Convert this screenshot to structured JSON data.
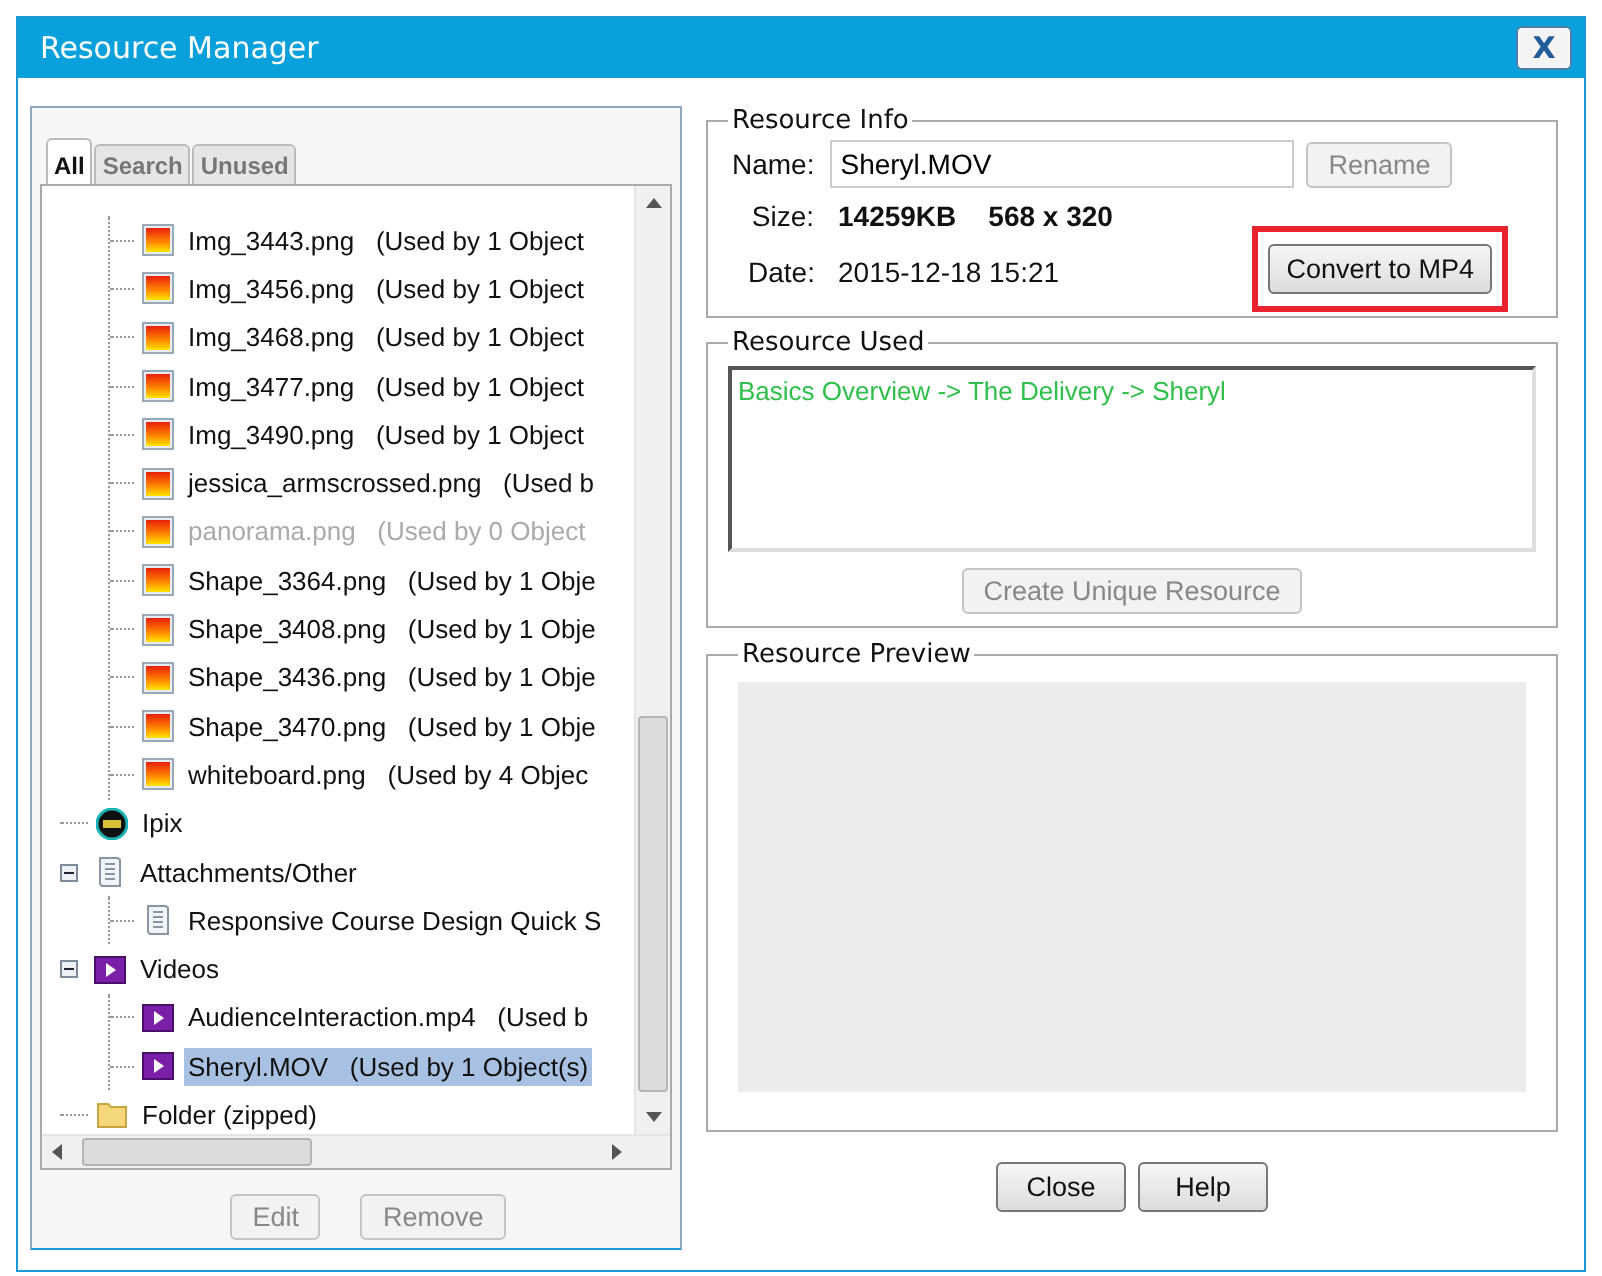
{
  "window": {
    "title": "Resource Manager",
    "close_label": "X"
  },
  "tabs": [
    {
      "label": "All",
      "selected": true
    },
    {
      "label": "Search",
      "selected": false
    },
    {
      "label": "Unused",
      "selected": false
    }
  ],
  "tree": {
    "scrolled_children": [
      {
        "kind": "image",
        "name": "Img_3443.png",
        "usage": "(Used by 1 Object",
        "dimmed": false,
        "selected": false
      },
      {
        "kind": "image",
        "name": "Img_3456.png",
        "usage": "(Used by 1 Object",
        "dimmed": false,
        "selected": false
      },
      {
        "kind": "image",
        "name": "Img_3468.png",
        "usage": "(Used by 1 Object",
        "dimmed": false,
        "selected": false
      },
      {
        "kind": "image",
        "name": "Img_3477.png",
        "usage": "(Used by 1 Object",
        "dimmed": false,
        "selected": false
      },
      {
        "kind": "image",
        "name": "Img_3490.png",
        "usage": "(Used by 1 Object",
        "dimmed": false,
        "selected": false
      },
      {
        "kind": "image",
        "name": "jessica_armscrossed.png",
        "usage": "(Used b",
        "dimmed": false,
        "selected": false
      },
      {
        "kind": "image",
        "name": "panorama.png",
        "usage": "(Used by 0 Object",
        "dimmed": true,
        "selected": false
      },
      {
        "kind": "image",
        "name": "Shape_3364.png",
        "usage": "(Used by 1 Obje",
        "dimmed": false,
        "selected": false
      },
      {
        "kind": "image",
        "name": "Shape_3408.png",
        "usage": "(Used by 1 Obje",
        "dimmed": false,
        "selected": false
      },
      {
        "kind": "image",
        "name": "Shape_3436.png",
        "usage": "(Used by 1 Obje",
        "dimmed": false,
        "selected": false
      },
      {
        "kind": "image",
        "name": "Shape_3470.png",
        "usage": "(Used by 1 Obje",
        "dimmed": false,
        "selected": false
      },
      {
        "kind": "image",
        "name": "whiteboard.png",
        "usage": "(Used by 4 Objec",
        "dimmed": false,
        "selected": false
      }
    ],
    "nodes": [
      {
        "kind": "ipix",
        "name": "Ipix",
        "selected": false
      },
      {
        "kind": "document",
        "name": "Attachments/Other",
        "expanded": true,
        "selected": false,
        "children": [
          {
            "kind": "document",
            "name": "Responsive Course Design Quick S",
            "dimmed": false,
            "selected": false
          }
        ]
      },
      {
        "kind": "video",
        "name": "Videos",
        "expanded": true,
        "selected": false,
        "children": [
          {
            "kind": "video",
            "name": "AudienceInteraction.mp4",
            "usage": "(Used b",
            "dimmed": false,
            "selected": false
          },
          {
            "kind": "video",
            "name": "Sheryl.MOV",
            "usage": "(Used by 1 Object(s)",
            "dimmed": false,
            "selected": true
          }
        ]
      },
      {
        "kind": "folder",
        "name": "Folder (zipped)",
        "selected": false
      }
    ]
  },
  "left_buttons": [
    {
      "label": "Edit",
      "disabled": true
    },
    {
      "label": "Remove",
      "disabled": true
    }
  ],
  "resource_info": {
    "legend": "Resource Info",
    "name_label": "Name:",
    "name_value": "Sheryl.MOV",
    "rename": {
      "label": "Rename",
      "disabled": true
    },
    "size_label": "Size:",
    "size": "14259KB",
    "dimensions": "568 x 320",
    "date_label": "Date:",
    "date": "2015-12-18 15:21",
    "convert": {
      "label": "Convert to MP4",
      "disabled": false,
      "highlighted": true
    }
  },
  "resource_used": {
    "legend": "Resource Used",
    "items": [
      "Basics Overview -> The Delivery -> Sheryl"
    ],
    "create": {
      "label": "Create Unique Resource",
      "disabled": true
    }
  },
  "resource_preview": {
    "legend": "Resource Preview"
  },
  "footer_buttons": [
    {
      "label": "Close",
      "disabled": false
    },
    {
      "label": "Help",
      "disabled": false
    }
  ]
}
